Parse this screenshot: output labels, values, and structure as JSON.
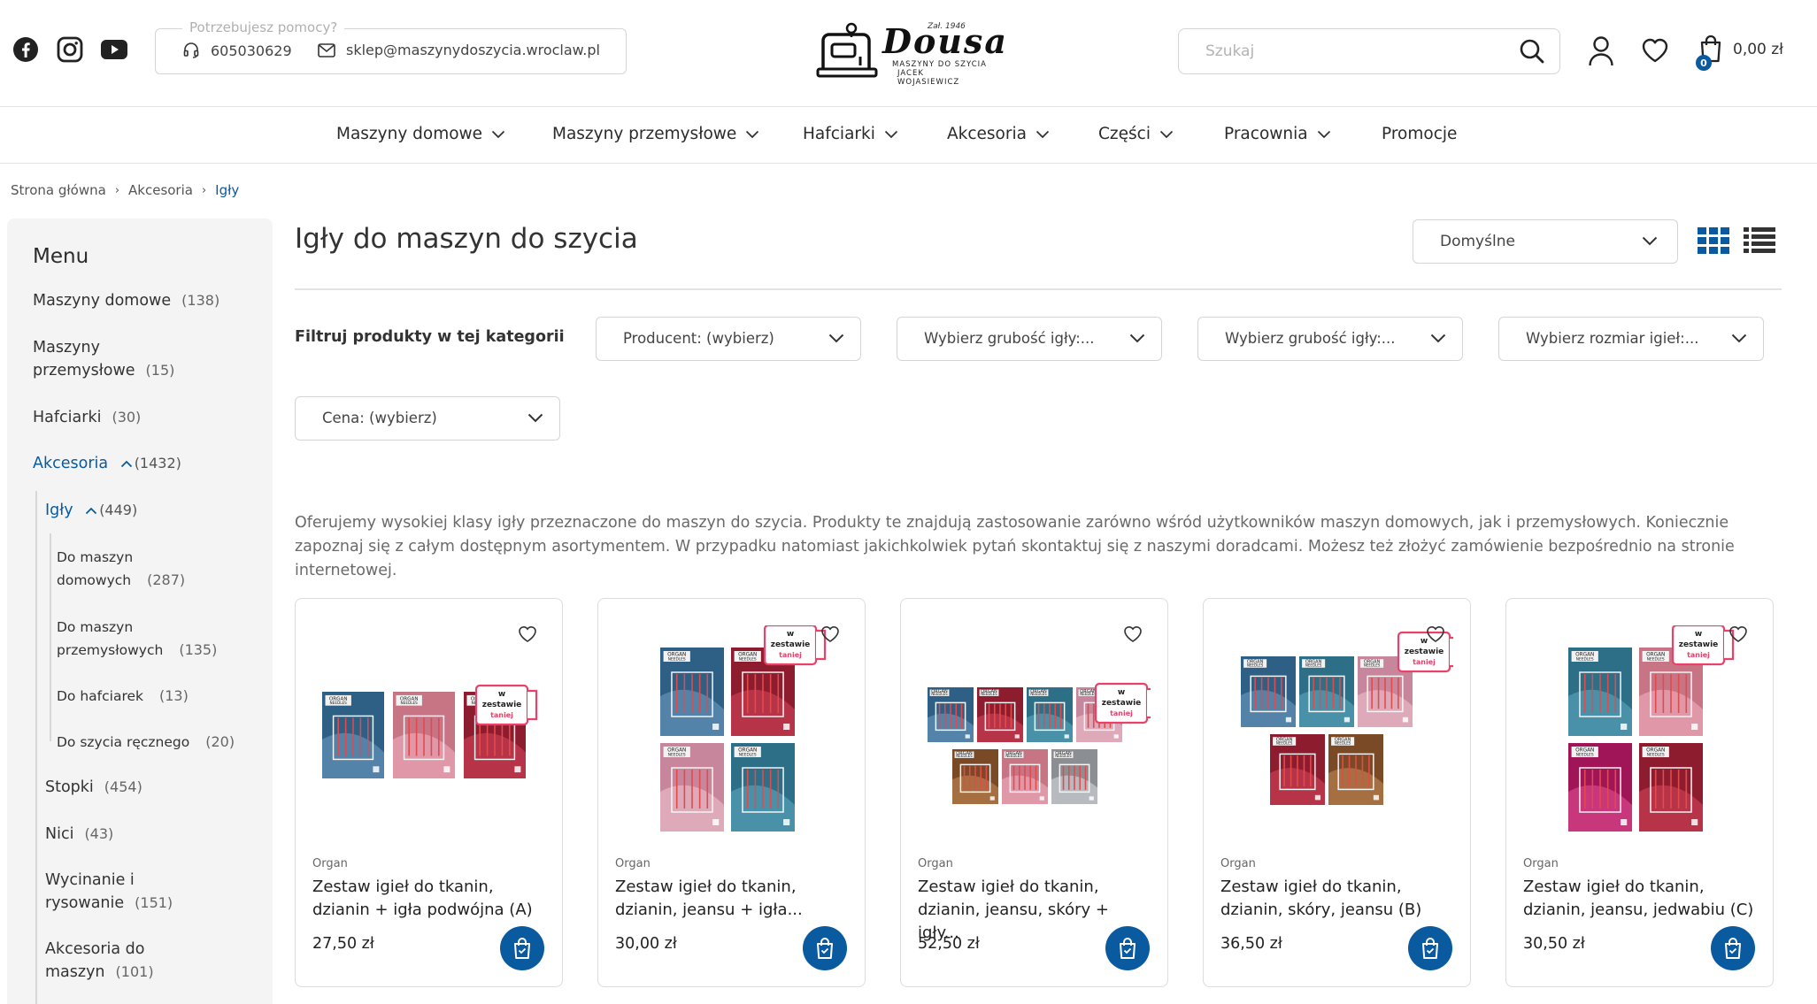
{
  "header": {
    "social_icons": [
      "facebook-icon",
      "instagram-icon",
      "youtube-icon"
    ],
    "help": {
      "legend": "Potrzebujesz pomocy?",
      "phone": "605030629",
      "email": "sklep@maszynydoszycia.wroclaw.pl"
    },
    "logo": {
      "brand": "Dousa",
      "est": "Zał. 1946",
      "line1": "MASZYNY DO SZYCIA",
      "line2": "JACEK WOJASIEWICZ"
    },
    "search": {
      "placeholder": "Szukaj",
      "value": ""
    },
    "cart": {
      "count": "0",
      "total": "0,00 zł"
    }
  },
  "nav": {
    "items": [
      {
        "label": "Maszyny domowe",
        "dropdown": true
      },
      {
        "label": "Maszyny przemysłowe",
        "dropdown": true
      },
      {
        "label": "Hafciarki",
        "dropdown": true
      },
      {
        "label": "Akcesoria",
        "dropdown": true
      },
      {
        "label": "Części",
        "dropdown": true
      },
      {
        "label": "Pracownia",
        "dropdown": true
      },
      {
        "label": "Promocje",
        "dropdown": false
      }
    ]
  },
  "breadcrumb": [
    "Strona główna",
    "Akcesoria",
    "Igły"
  ],
  "sidebar": {
    "title": "Menu",
    "items": [
      {
        "label": "Maszyny domowe",
        "count": "(138)"
      },
      {
        "label_line1": "Maszyny",
        "label_line2": "przemysłowe",
        "count": "(15)"
      },
      {
        "label": "Hafciarki",
        "count": "(30)"
      },
      {
        "label": "Akcesoria",
        "count": "(1432)"
      },
      {
        "label": "Igły",
        "count": "(449)"
      },
      {
        "label_line1": "Do maszyn",
        "label_line2": "domowych",
        "count": "(287)"
      },
      {
        "label_line1": "Do maszyn",
        "label_line2": "przemysłowych",
        "count": "(135)"
      },
      {
        "label": "Do hafciarek",
        "count": "(13)"
      },
      {
        "label": "Do szycia ręcznego",
        "count": "(20)"
      },
      {
        "label": "Stopki",
        "count": "(454)"
      },
      {
        "label": "Nici",
        "count": "(43)"
      },
      {
        "label_line1": "Wycinanie i",
        "label_line2": "rysowanie",
        "count": "(151)"
      },
      {
        "label_line1": "Akcesoria do",
        "label_line2": "maszyn",
        "count": "(101)"
      }
    ]
  },
  "main": {
    "title": "Igły do maszyn do szycia",
    "sort": {
      "selected": "Domyślne"
    },
    "filter_label": "Filtruj produkty w tej kategorii",
    "filters": [
      "Producent: (wybierz)",
      "Wybierz grubość igły:...",
      "Wybierz grubość igły:...",
      "Wybierz rozmiar igieł:...",
      "Cena: (wybierz)"
    ],
    "description": "Oferujemy wysokiej klasy igły przeznaczone do maszyn do szycia. Produkty te znajdują zastosowanie zarówno wśród użytkowników maszyn domowych, jak i przemysłowych. Koniecznie zapoznaj się z całym dostępnym asortymentem. W przypadku natomiast jakichkolwiek pytań skontaktuj się z naszymi doradcami. Możesz też złożyć zamówienie bezpośrednio na stronie internetowej."
  },
  "products": [
    {
      "brand": "Organ",
      "name": "Zestaw igieł do tkanin, dzianin + igła podwójna (A)",
      "price": "27,50 zł",
      "badge": [
        "w",
        "zestawie",
        "taniej"
      ]
    },
    {
      "brand": "Organ",
      "name": "Zestaw igieł do tkanin, dzianin, jeansu + igła...",
      "price": "30,00 zł",
      "badge": [
        "w",
        "zestawie",
        "taniej"
      ]
    },
    {
      "brand": "Organ",
      "name": "Zestaw igieł do tkanin, dzianin, jeansu, skóry + igły...",
      "price": "52,50 zł",
      "badge": [
        "w",
        "zestawie",
        "taniej"
      ]
    },
    {
      "brand": "Organ",
      "name": "Zestaw igieł do tkanin, dzianin, skóry, jeansu (B)",
      "price": "36,50 zł",
      "badge": [
        "w",
        "zestawie",
        "taniej"
      ]
    },
    {
      "brand": "Organ",
      "name": "Zestaw igieł do tkanin, dzianin, jeansu, jedwabiu (C)",
      "price": "30,50 zł",
      "badge": [
        "w",
        "zestawie",
        "taniej"
      ]
    }
  ],
  "package_labels": {
    "maker_line1": "ORGAN",
    "maker_line2": "NEEDLES"
  },
  "colors": {
    "accent": "#0a5aa0",
    "badge": "#e8426a"
  }
}
